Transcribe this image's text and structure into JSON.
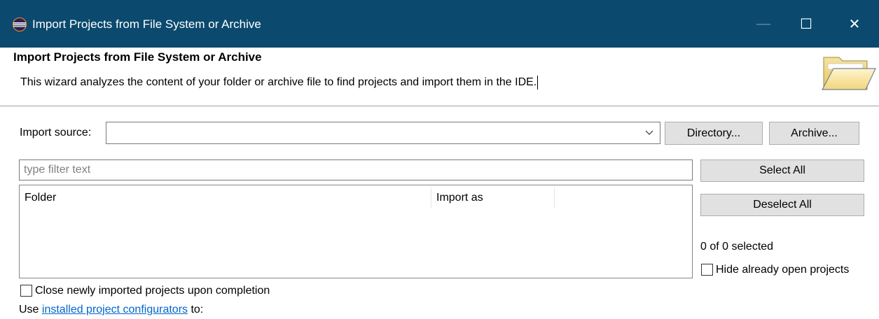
{
  "window": {
    "title": "Import Projects from File System or Archive",
    "controls": {
      "minimize": "—",
      "maximize": "☐",
      "close": "✕"
    }
  },
  "header": {
    "title": "Import Projects from File System or Archive",
    "description": "This wizard analyzes the content of your folder or archive file to find projects and import them in the IDE."
  },
  "import_source": {
    "label": "Import source:",
    "value": "",
    "directory_button": "Directory...",
    "archive_button": "Archive..."
  },
  "filter": {
    "placeholder": "type filter text",
    "value": ""
  },
  "projects_table": {
    "columns": [
      "Folder",
      "Import as",
      ""
    ],
    "rows": []
  },
  "side_panel": {
    "select_all": "Select All",
    "deselect_all": "Deselect All",
    "selection_status": "0 of 0 selected",
    "hide_open_label": "Hide already open projects",
    "hide_open_checked": false
  },
  "options": {
    "close_newly_imported_label": "Close newly imported projects upon completion",
    "close_newly_imported_checked": false,
    "configurators_prefix": "Use ",
    "configurators_link": "installed project configurators",
    "configurators_suffix": " to:"
  },
  "colors": {
    "titlebar": "#0b4a6e",
    "button_face": "#e1e1e1",
    "link": "#0066cc"
  }
}
